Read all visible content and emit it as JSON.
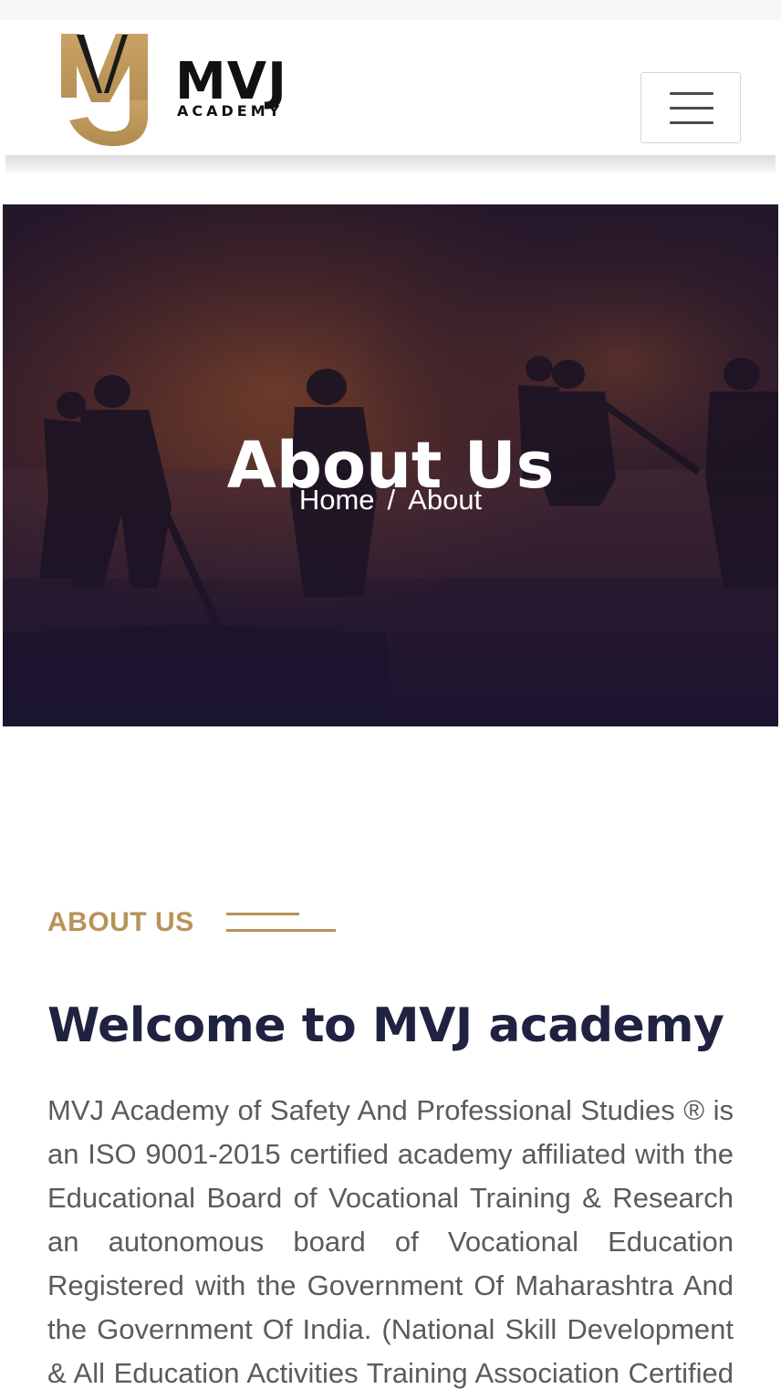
{
  "header": {
    "logo_text": "MVJ",
    "logo_subtext": "ACADEMY",
    "menu_button_label": ""
  },
  "hero": {
    "title": "About Us",
    "breadcrumb": {
      "home": "Home",
      "separator": "/",
      "current": "About"
    }
  },
  "about": {
    "label": "ABOUT US",
    "title": "Welcome to MVJ academy",
    "body": "MVJ Academy of Safety And Professional Studies ® is an ISO 9001-2015 certified academy affiliated with the Educational Board of Vocational Training & Research an autonomous board of Vocational Education Registered with the Government Of Maharashtra And the Government Of India. (National Skill Development & All Education Activities Training Association Certified Board) is an organization"
  },
  "colors": {
    "accent_gold": "#b89358",
    "title_navy": "#1f2240",
    "body_gray": "#5b5b5b",
    "hero_overlay": "#22152a"
  },
  "icons": {
    "menu": "hamburger-icon",
    "logo": "mvj-logo-mark"
  }
}
